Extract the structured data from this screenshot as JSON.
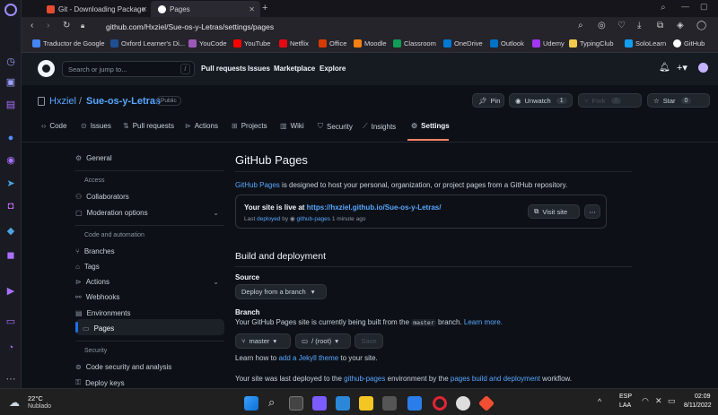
{
  "browser": {
    "tabs": [
      {
        "label": "Git - Downloading Package",
        "active": false
      },
      {
        "label": "Pages",
        "active": true
      }
    ],
    "url": "github.com/Hxziel/Sue-os-y-Letras/settings/pages",
    "bookmarks": [
      "Traductor de Google",
      "Oxford Learner's Di...",
      "YouCode",
      "YouTube",
      "Netflix",
      "Office",
      "Moodle",
      "Classroom",
      "OneDrive",
      "Outlook",
      "Udemy",
      "TypingClub",
      "SoloLearn",
      "GitHub"
    ]
  },
  "header": {
    "search_placeholder": "Search or jump to...",
    "search_key": "/",
    "links": [
      "Pull requests",
      "Issues",
      "Marketplace",
      "Explore"
    ]
  },
  "repo": {
    "owner": "Hxziel",
    "separator": "/",
    "name": "Sue-os-y-Letras",
    "visibility": "Public",
    "pin_label": "Pin",
    "unwatch_label": "Unwatch",
    "unwatch_count": "1",
    "fork_label": "Fork",
    "fork_count": "0",
    "star_label": "Star",
    "star_count": "0",
    "tabs": [
      "Code",
      "Issues",
      "Pull requests",
      "Actions",
      "Projects",
      "Wiki",
      "Security",
      "Insights",
      "Settings"
    ]
  },
  "settings_nav": {
    "general": "General",
    "access_heading": "Access",
    "collaborators": "Collaborators",
    "moderation": "Moderation options",
    "automation_heading": "Code and automation",
    "branches": "Branches",
    "tags": "Tags",
    "actions": "Actions",
    "webhooks": "Webhooks",
    "environments": "Environments",
    "pages": "Pages",
    "security_heading": "Security",
    "code_security": "Code security and analysis",
    "deploy_keys": "Deploy keys"
  },
  "pages": {
    "title": "GitHub Pages",
    "intro_link": "GitHub Pages",
    "intro_rest": " is designed to host your personal, organization, or project pages from a GitHub repository.",
    "live_label": "Your site is live at ",
    "live_url": "https://hxziel.github.io/Sue-os-y-Letras/",
    "last_word": "Last ",
    "deployed_link": "deployed",
    "by_text": " by ",
    "bot_link": "github-pages",
    "time_ago": " 1 minute ago",
    "visit_label": "Visit site",
    "build_title": "Build and deployment",
    "source_label": "Source",
    "source_value": "Deploy from a branch",
    "branch_label": "Branch",
    "branch_desc_a": "Your GitHub Pages site is currently being built from the ",
    "branch_code": "master",
    "branch_desc_b": " branch. ",
    "learn_more": "Learn more.",
    "branch_value": "master",
    "folder_value": "/ (root)",
    "save_label": "Save",
    "jekyll_a": "Learn how to ",
    "jekyll_link": "add a Jekyll theme",
    "jekyll_b": " to your site.",
    "deploy_a": "Your site was last deployed to the ",
    "deploy_link1": "github-pages",
    "deploy_b": " environment by the ",
    "deploy_link2": "pages build and deployment",
    "deploy_c": " workflow."
  },
  "taskbar": {
    "temp": "22°C",
    "weather": "Nublado",
    "lang1": "ESP",
    "lang2": "LAA",
    "time": "02:09",
    "date": "8/11/2022"
  }
}
